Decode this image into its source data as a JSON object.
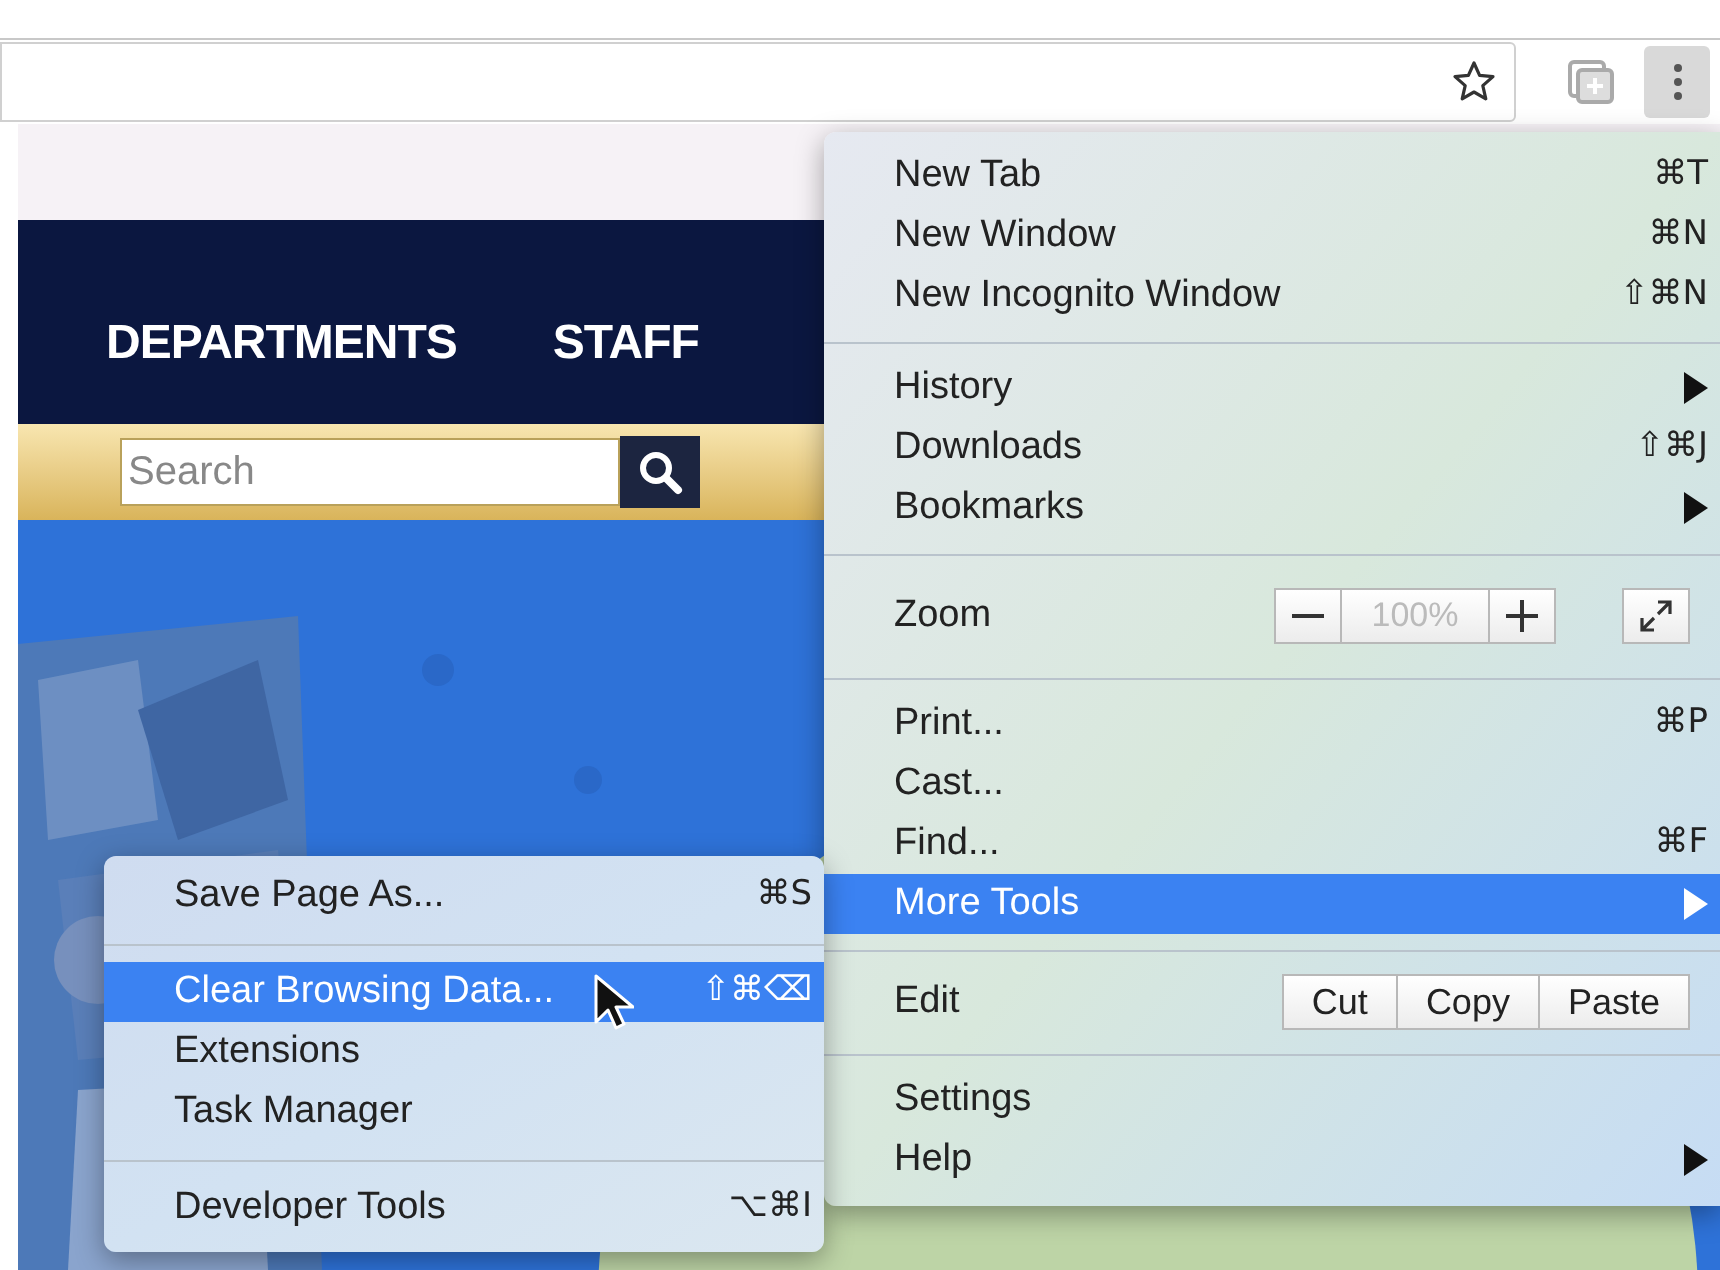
{
  "page": {
    "nav_items": [
      "DEPARTMENTS",
      "STAFF"
    ],
    "search": {
      "placeholder": "Search"
    },
    "hero": {
      "kind": "picture"
    }
  },
  "menu": {
    "items": [
      {
        "kind": "item",
        "label": "New Tab",
        "shortcut": "⌘T",
        "submenu": false,
        "selected": false
      },
      {
        "kind": "item",
        "label": "New Window",
        "shortcut": "⌘N",
        "submenu": false,
        "selected": false
      },
      {
        "kind": "item",
        "label": "New Incognito Window",
        "shortcut": "⇧⌘N",
        "submenu": false,
        "selected": false
      },
      {
        "kind": "separator"
      },
      {
        "kind": "item",
        "label": "History",
        "submenu": true,
        "selected": false
      },
      {
        "kind": "item",
        "label": "Downloads",
        "shortcut": "⇧⌘J",
        "submenu": false,
        "selected": false
      },
      {
        "kind": "item",
        "label": "Bookmarks",
        "submenu": true,
        "selected": false
      },
      {
        "kind": "separator"
      },
      {
        "kind": "zoom",
        "label": "Zoom",
        "value": "100%"
      },
      {
        "kind": "separator"
      },
      {
        "kind": "item",
        "label": "Print...",
        "shortcut": "⌘P",
        "submenu": false,
        "selected": false
      },
      {
        "kind": "item",
        "label": "Cast...",
        "submenu": false,
        "selected": false
      },
      {
        "kind": "item",
        "label": "Find...",
        "shortcut": "⌘F",
        "submenu": false,
        "selected": false
      },
      {
        "kind": "item",
        "label": "More Tools",
        "submenu": true,
        "selected": true
      },
      {
        "kind": "separator"
      },
      {
        "kind": "edit",
        "label": "Edit",
        "buttons": [
          "Cut",
          "Copy",
          "Paste"
        ]
      },
      {
        "kind": "separator"
      },
      {
        "kind": "item",
        "label": "Settings",
        "submenu": false,
        "selected": false
      },
      {
        "kind": "item",
        "label": "Help",
        "submenu": true,
        "selected": false
      }
    ]
  },
  "submenu": {
    "items": [
      {
        "kind": "item",
        "label": "Save Page As...",
        "shortcut": "⌘S",
        "selected": false
      },
      {
        "kind": "separator"
      },
      {
        "kind": "item",
        "label": "Clear Browsing Data...",
        "shortcut": "⇧⌘⌫",
        "selected": true
      },
      {
        "kind": "item",
        "label": "Extensions",
        "selected": false
      },
      {
        "kind": "item",
        "label": "Task Manager",
        "selected": false
      },
      {
        "kind": "separator"
      },
      {
        "kind": "item",
        "label": "Developer Tools",
        "shortcut": "⌥⌘I",
        "selected": false
      }
    ]
  }
}
